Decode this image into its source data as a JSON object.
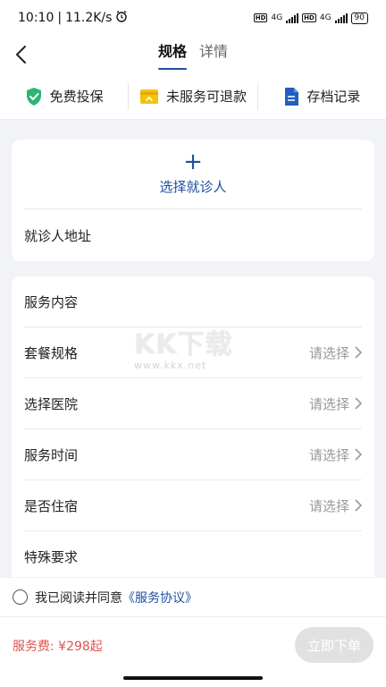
{
  "status": {
    "time": "10:10",
    "speed": "11.2K/s",
    "network1": "4G",
    "network2": "4G",
    "hd": "HD",
    "battery": "90"
  },
  "nav": {
    "tabs": [
      {
        "label": "规格",
        "active": true
      },
      {
        "label": "详情",
        "active": false
      }
    ]
  },
  "features": [
    {
      "label": "免费投保",
      "icon": "shield-check-icon",
      "color": "#2bb673"
    },
    {
      "label": "未服务可退款",
      "icon": "refund-icon",
      "color": "#f4c20d"
    },
    {
      "label": "存档记录",
      "icon": "document-icon",
      "color": "#1f5fbf"
    }
  ],
  "patient": {
    "add_label": "选择就诊人",
    "address_label": "就诊人地址"
  },
  "service": {
    "content_label": "服务内容",
    "rows": [
      {
        "label": "套餐规格",
        "value": "请选择"
      },
      {
        "label": "选择医院",
        "value": "请选择"
      },
      {
        "label": "服务时间",
        "value": "请选择"
      },
      {
        "label": "是否住宿",
        "value": "请选择"
      }
    ],
    "special_label": "特殊要求"
  },
  "watermark": {
    "big": "KK下载",
    "small": "www.kkx.net"
  },
  "agreement": {
    "prefix": "我已阅读并同意",
    "link": "《服务协议》"
  },
  "footer": {
    "fee": "服务费: ¥298起",
    "order_button": "立即下单"
  },
  "colors": {
    "accent": "#1f4ea3",
    "price": "#e05252"
  }
}
